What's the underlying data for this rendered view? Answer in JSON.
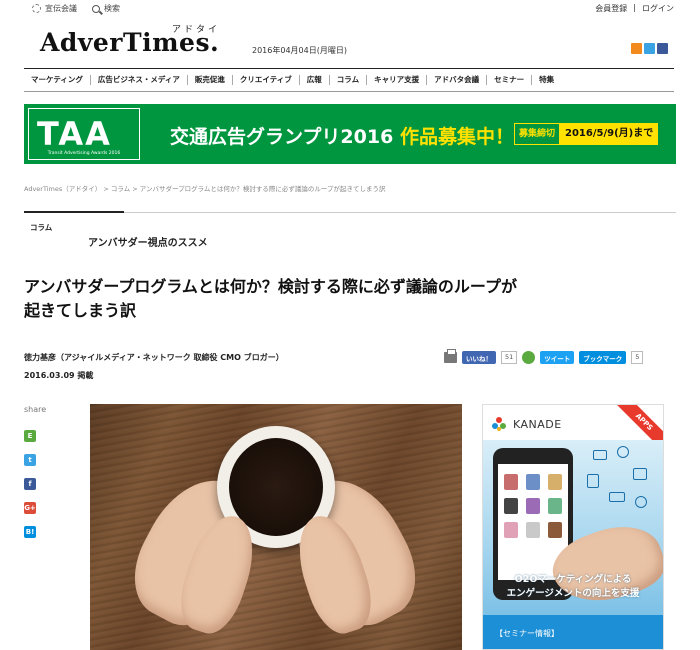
{
  "topbar": {
    "left_link": "宣伝会議",
    "search_label": "検索",
    "register": "会員登録",
    "login": "ログイン",
    "separator": "|"
  },
  "header": {
    "logo": "AdverTimes.",
    "logo_kana": "アドタイ",
    "date": "2016年04月04日(月曜日)"
  },
  "social_icons": [
    "rss-icon",
    "twitter-icon",
    "facebook-icon"
  ],
  "nav": [
    "マーケティング",
    "広告ビジネス・メディア",
    "販売促進",
    "クリエイティブ",
    "広報",
    "コラム",
    "キャリア支援",
    "アドバタ会議",
    "セミナー",
    "特集"
  ],
  "banner": {
    "logo_letters": "TAA",
    "logo_sub": "Transit Advertising Awards 2016",
    "headline_white": "交通広告グランプリ2016",
    "headline_yellow": "作品募集中！",
    "deadline_label": "募集締切",
    "deadline_date": "2016/5/9(月)まで",
    "colors": {
      "green": "#009640",
      "yellow": "#ffe100"
    }
  },
  "breadcrumb": "AdverTimes（アドタイ） > コラム > アンバサダープログラムとは何か？検討する際に必ず議論のループが起きてしまう訳",
  "article": {
    "section_label": "コラム",
    "series": "アンバサダー視点のススメ",
    "title_line1": "アンバサダープログラムとは何か？検討する際に必ず議論のループが",
    "title_line2": "起きてしまう訳",
    "author": "徳力基彦（アジャイルメディア・ネットワーク 取締役 CMO ブロガー）",
    "date": "2016.03.09 掲載"
  },
  "share_buttons": {
    "like_label": "いいね！",
    "like_count": "51",
    "tweet_label": "ツイート",
    "hatena_label": "ブックマーク",
    "hatena_count": "5"
  },
  "side_share": {
    "label": "share",
    "icons": [
      "evernote-icon",
      "twitter-icon",
      "facebook-icon",
      "google-plus-icon",
      "hatena-icon"
    ]
  },
  "ad": {
    "logo": "KANADE",
    "ribbon": "APPS",
    "caption_line1": "O2Oマーケティングによる",
    "caption_line2": "エンゲージメントの向上を支援",
    "footer": "【セミナー情報】"
  }
}
